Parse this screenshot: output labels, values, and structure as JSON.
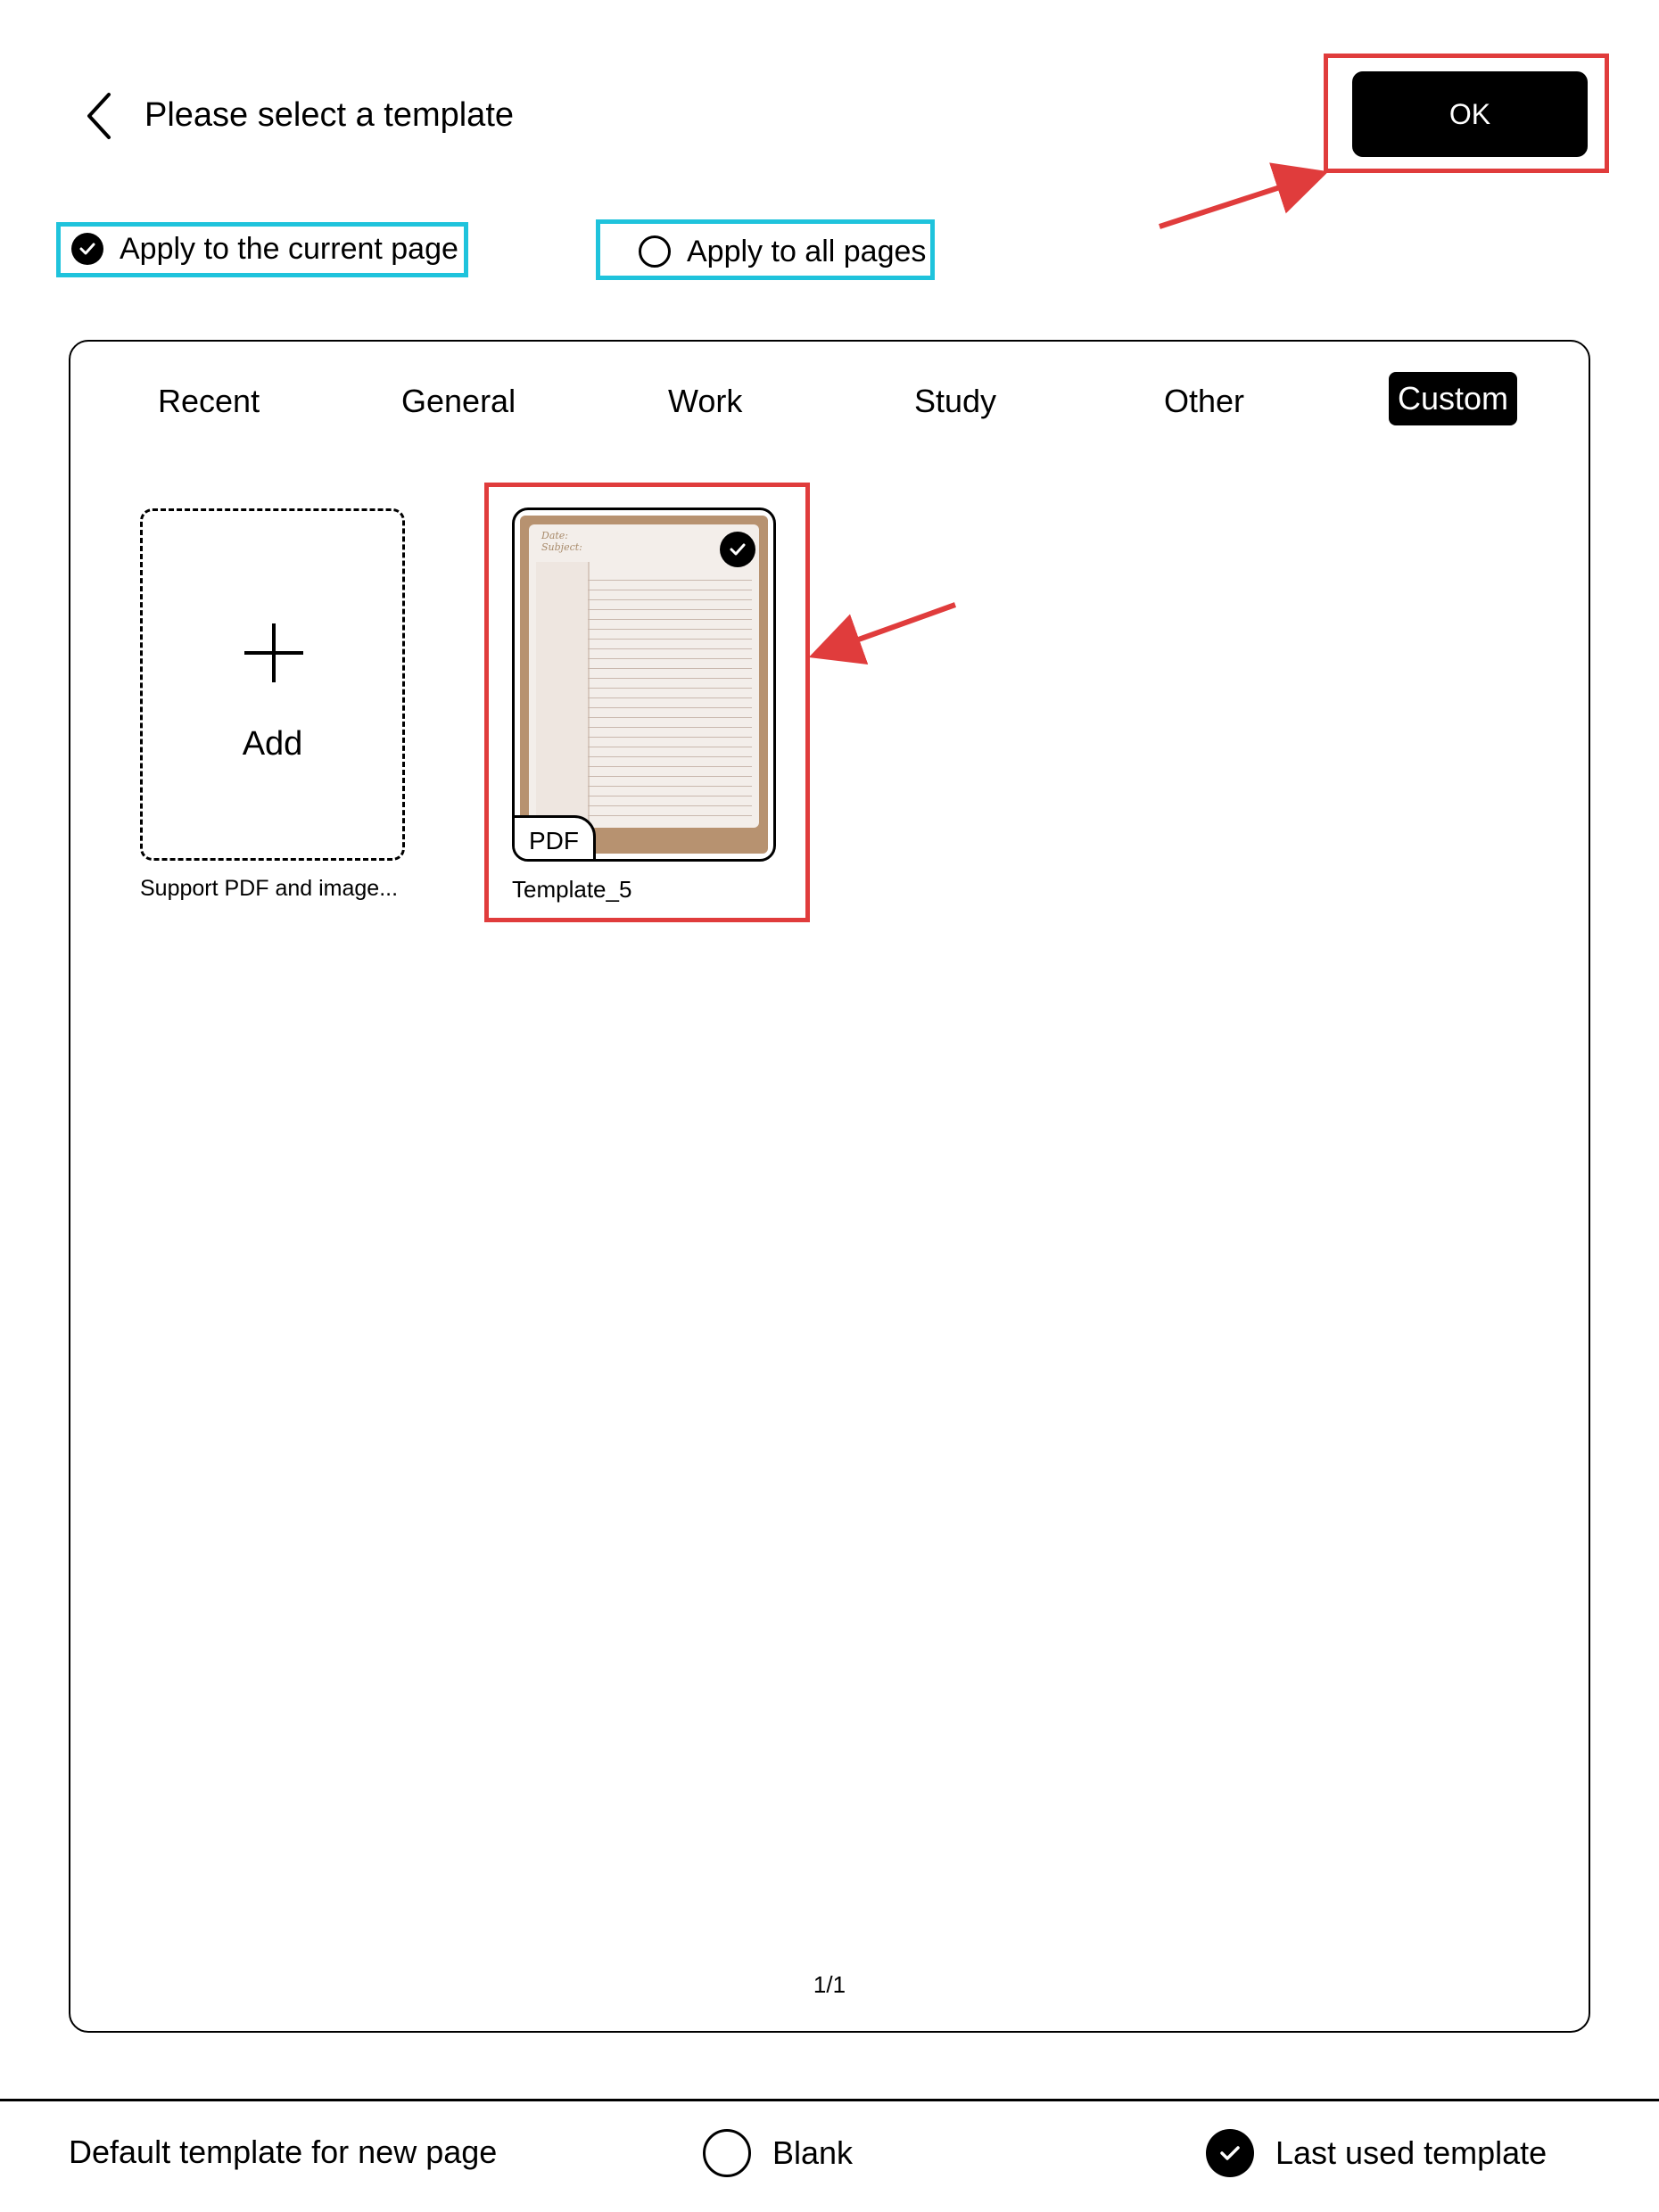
{
  "header": {
    "title": "Please select a template",
    "ok_label": "OK"
  },
  "apply_options": [
    {
      "label": "Apply to the current page",
      "selected": true
    },
    {
      "label": "Apply to all pages",
      "selected": false
    }
  ],
  "tabs": [
    {
      "label": "Recent",
      "active": false
    },
    {
      "label": "General",
      "active": false
    },
    {
      "label": "Work",
      "active": false
    },
    {
      "label": "Study",
      "active": false
    },
    {
      "label": "Other",
      "active": false
    },
    {
      "label": "Custom",
      "active": true
    }
  ],
  "add_card": {
    "label": "Add",
    "caption": "Support PDF and image..."
  },
  "templates": [
    {
      "name": "Template_5",
      "badge": "PDF",
      "selected": true,
      "thumb_text": {
        "date": "Date:",
        "subject": "Subject:"
      }
    }
  ],
  "pagination": "1/1",
  "footer": {
    "label": "Default template for new page",
    "options": [
      {
        "label": "Blank",
        "selected": false
      },
      {
        "label": "Last used template",
        "selected": true
      }
    ]
  },
  "colors": {
    "annotation_red": "#e03c3c",
    "annotation_cyan": "#1fc3dc",
    "thumb_frame": "#b79270"
  }
}
